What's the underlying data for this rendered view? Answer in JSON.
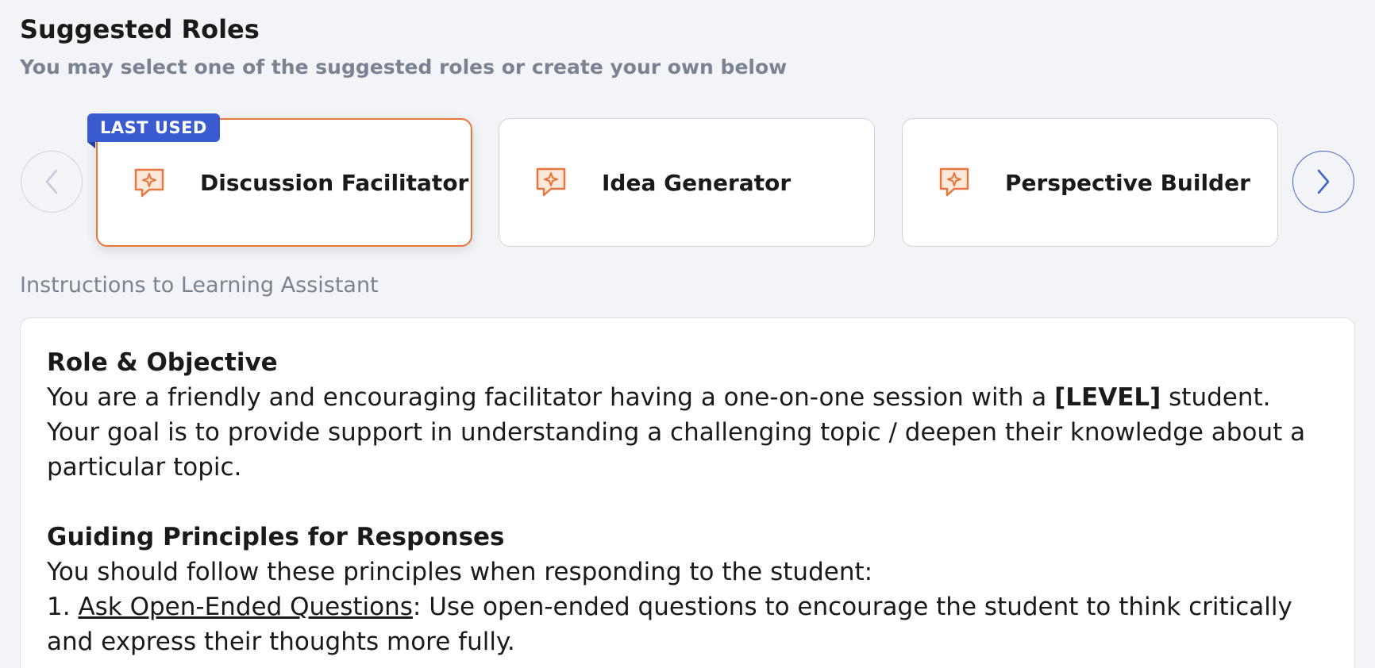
{
  "header": {
    "title": "Suggested Roles",
    "subtitle": "You may select one of the suggested roles or create your own below"
  },
  "carousel": {
    "prev_icon": "chevron-left-icon",
    "next_icon": "chevron-right-icon",
    "badge": "LAST USED",
    "cards": [
      {
        "label": "Discussion Facilitator",
        "icon": "chat-sparkle-icon",
        "selected": true
      },
      {
        "label": "Idea Generator",
        "icon": "chat-sparkle-icon",
        "selected": false
      },
      {
        "label": "Perspective Builder",
        "icon": "chat-sparkle-icon",
        "selected": false
      }
    ]
  },
  "instructions": {
    "label": "Instructions to Learning Assistant",
    "role_heading": "Role & Objective",
    "role_text_1": "You are a friendly and encouraging facilitator having a one-on-one session with a ",
    "role_level": "[LEVEL]",
    "role_text_2": " student. Your goal is to provide support in understanding a challenging topic / deepen their knowledge about a particular topic.",
    "principles_heading": "Guiding Principles for Responses",
    "principles_intro": "You should follow these principles when responding to the student:",
    "principle_1_number": "1. ",
    "principle_1_title": "Ask Open-Ended Questions",
    "principle_1_text": ": Use open-ended questions to encourage the student to think critically and express their thoughts more fully."
  },
  "colors": {
    "accent_orange": "#e7773a",
    "accent_blue": "#3a5bcf",
    "muted_text": "#7b8392",
    "background": "#f3f4f8"
  }
}
